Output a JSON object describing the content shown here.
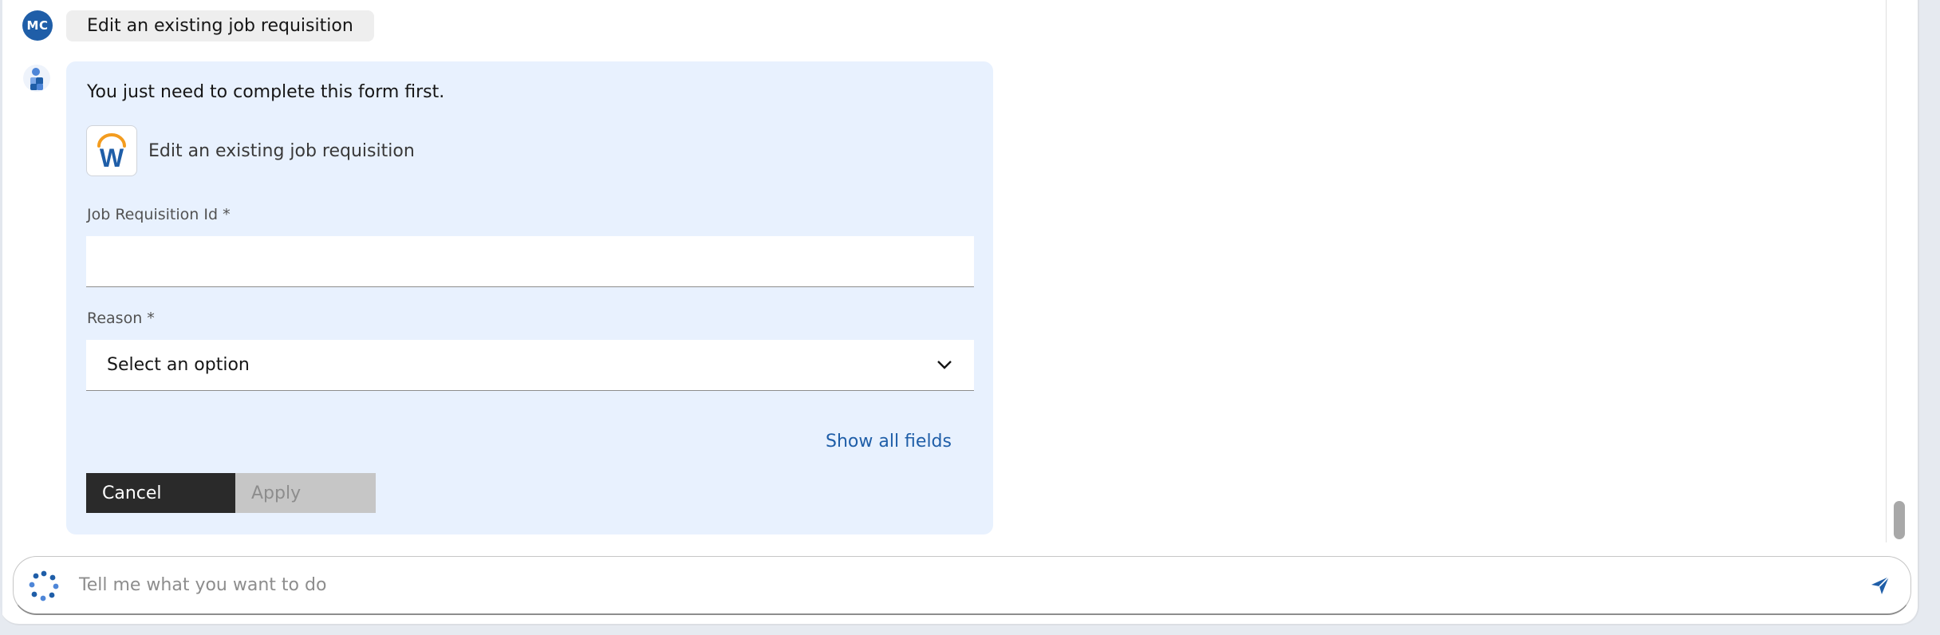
{
  "user_message": {
    "avatar_initials": "MC",
    "text": "Edit an existing job requisition"
  },
  "bot_card": {
    "intro": "You just need to complete this form first.",
    "app": {
      "name": "Edit an existing job requisition",
      "logo_icon": "workday-logo"
    },
    "fields": {
      "job_req_label": "Job Requisition Id *",
      "job_req_value": "",
      "reason_label": "Reason *",
      "reason_selected": "Select an option"
    },
    "show_all_fields": "Show all fields",
    "buttons": {
      "cancel": "Cancel",
      "apply": "Apply"
    }
  },
  "composer": {
    "placeholder": "Tell me what you want to do",
    "send_icon": "send-icon"
  },
  "colors": {
    "accent": "#1f5ea8",
    "card_bg": "#e8f1fe",
    "cancel_bg": "#2a2a2a",
    "apply_disabled_bg": "#c6c6c6",
    "logo_orange": "#f39c1f"
  }
}
